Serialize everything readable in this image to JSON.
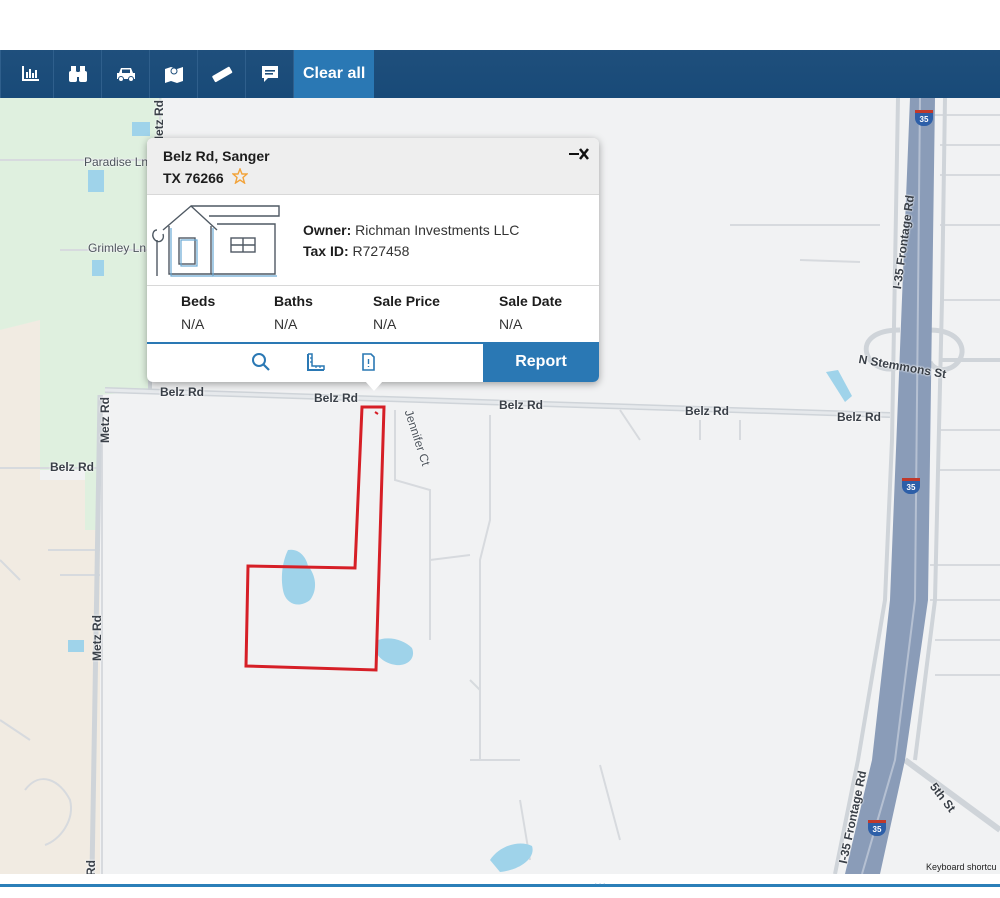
{
  "toolbar": {
    "tools": [
      {
        "name": "analytics-icon"
      },
      {
        "name": "binoculars-icon"
      },
      {
        "name": "car-icon"
      },
      {
        "name": "map-icon"
      },
      {
        "name": "ruler-icon"
      },
      {
        "name": "comment-icon"
      }
    ],
    "clear_label": "Clear all"
  },
  "map": {
    "roads": {
      "belz_1": "Belz Rd",
      "belz_2": "Belz Rd",
      "belz_3": "Belz Rd",
      "belz_4": "Belz Rd",
      "belz_5": "Belz Rd",
      "belz_west": "Belz Rd",
      "metz_top": "Metz Rd",
      "metz_mid": "Metz Rd",
      "metz_low": "Metz Rd",
      "metz_bottom": "Rd",
      "paradise": "Paradise Ln",
      "grimley": "Grimley Ln",
      "jennifer": "Jennifer Ct",
      "frontage_top": "I-35 Frontage Rd",
      "frontage_bottom": "I-35 Frontage Rd",
      "stemmons": "N Stemmons St",
      "fifth": "5th St"
    },
    "shields": [
      "35",
      "35",
      "35"
    ],
    "keyboard_label": "Keyboard shortcu"
  },
  "popup": {
    "address_line1": "Belz Rd, Sanger",
    "address_line2": "TX 76266",
    "owner_label": "Owner:",
    "owner_value": "Richman Investments LLC",
    "taxid_label": "Tax ID:",
    "taxid_value": "R727458",
    "stats": [
      {
        "label": "Beds",
        "value": "N/A"
      },
      {
        "label": "Baths",
        "value": "N/A"
      },
      {
        "label": "Sale Price",
        "value": "N/A"
      },
      {
        "label": "Sale Date",
        "value": "N/A"
      }
    ],
    "report_label": "Report",
    "actions": [
      "search-icon",
      "measure-icon",
      "document-icon"
    ]
  },
  "colors": {
    "toolbar": "#1f4f7c",
    "accent": "#2a78b4",
    "parcel": "#d61f26",
    "water": "#9fd3ea",
    "park": "#dff0df",
    "sand": "#f1ebe2",
    "highway": "#8a9cb8"
  },
  "footer": {
    "handle": "..."
  }
}
